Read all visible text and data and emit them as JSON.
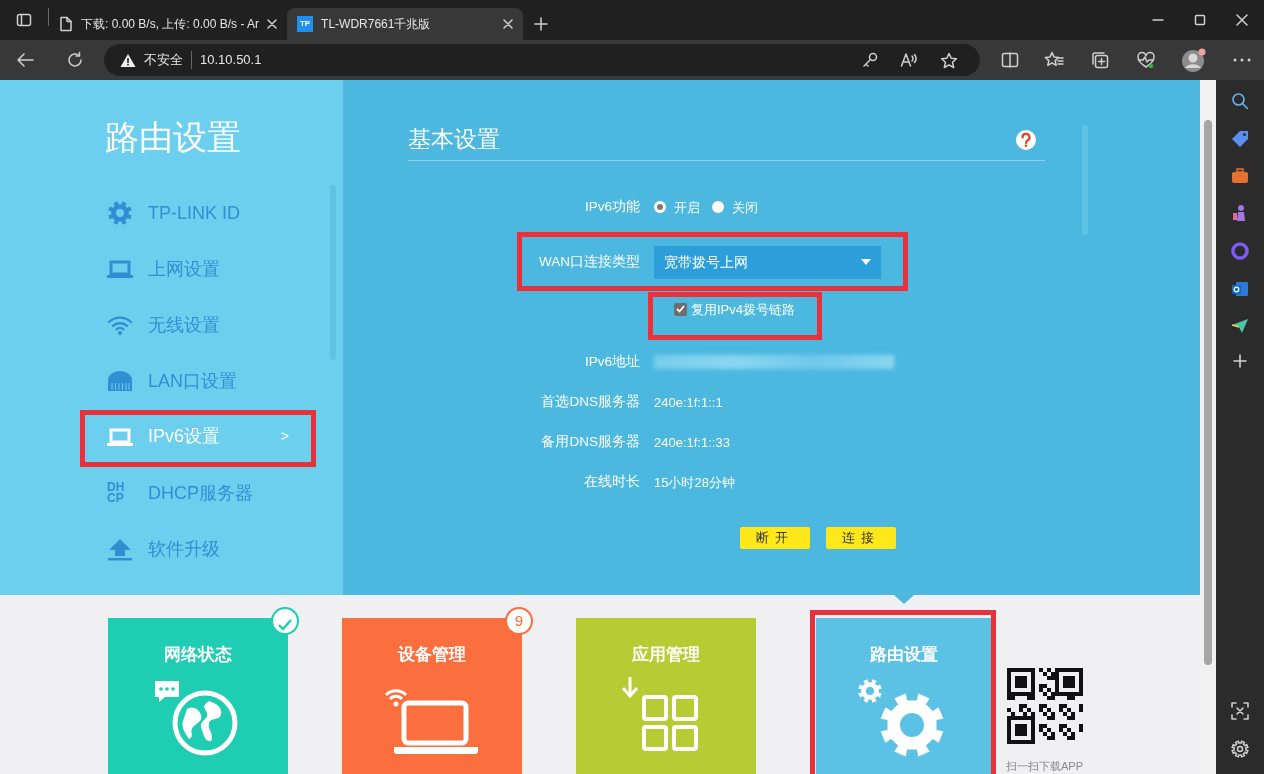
{
  "browser": {
    "tabs": [
      {
        "title": "下载: 0.00 B/s, 上传: 0.00 B/s - Ar",
        "kind": "document",
        "selected": false
      },
      {
        "title": "TL-WDR7661千兆版",
        "kind": "logo",
        "icon_text": "TP",
        "selected": true
      }
    ],
    "security": "不安全",
    "url": "10.10.50.1"
  },
  "sidebar": {
    "title": "路由设置",
    "items": [
      {
        "label": "TP-LINK ID",
        "kind": "gear",
        "selected": false,
        "highlighted": false
      },
      {
        "label": "上网设置",
        "kind": "laptop",
        "selected": false,
        "highlighted": false
      },
      {
        "label": "无线设置",
        "kind": "wifi",
        "selected": false,
        "highlighted": false
      },
      {
        "label": "LAN口设置",
        "kind": "port",
        "selected": false,
        "highlighted": false
      },
      {
        "label": "IPv6设置",
        "kind": "laptop",
        "selected": true,
        "suffix": ">",
        "highlighted": true
      },
      {
        "label": "DHCP服务器",
        "kind": "text",
        "icon_text": "DHCP",
        "selected": false,
        "highlighted": false
      },
      {
        "label": "软件升级",
        "kind": "upload",
        "selected": false,
        "highlighted": false
      }
    ]
  },
  "panel": {
    "title": "基本设置",
    "ipv6_function": {
      "label": "IPv6功能",
      "options": [
        {
          "label": "开启",
          "selected": true
        },
        {
          "label": "关闭",
          "selected": false
        }
      ]
    },
    "wan_type": {
      "label": "WAN口连接类型",
      "value": "宽带拨号上网",
      "highlighted": true
    },
    "reuse_ipv4": {
      "label": "复用IPv4拨号链路",
      "checked": true,
      "highlighted": true
    },
    "fields": [
      {
        "label": "IPv6地址",
        "redacted": true
      },
      {
        "label": "首选DNS服务器",
        "value": "240e:1f:1::1"
      },
      {
        "label": "备用DNS服务器",
        "value": "240e:1f:1::33"
      },
      {
        "label": "在线时长",
        "value": "15小时28分钟"
      }
    ],
    "buttons": [
      "断开",
      "连接"
    ]
  },
  "tiles": [
    {
      "label": "网络状态",
      "kind": "network",
      "color": "#1fcdb2",
      "badge": {
        "kind": "check"
      },
      "selected": false,
      "highlighted": false
    },
    {
      "label": "设备管理",
      "kind": "devices",
      "color": "#fb6e3e",
      "badge": {
        "kind": "count",
        "text": "9"
      },
      "selected": false,
      "highlighted": false
    },
    {
      "label": "应用管理",
      "kind": "apps",
      "color": "#b6cc34",
      "selected": false,
      "highlighted": false
    },
    {
      "label": "路由设置",
      "kind": "router",
      "color": "#5bc2e5",
      "selected": true,
      "highlighted": true
    }
  ],
  "qr_caption": "扫一扫下载APP"
}
